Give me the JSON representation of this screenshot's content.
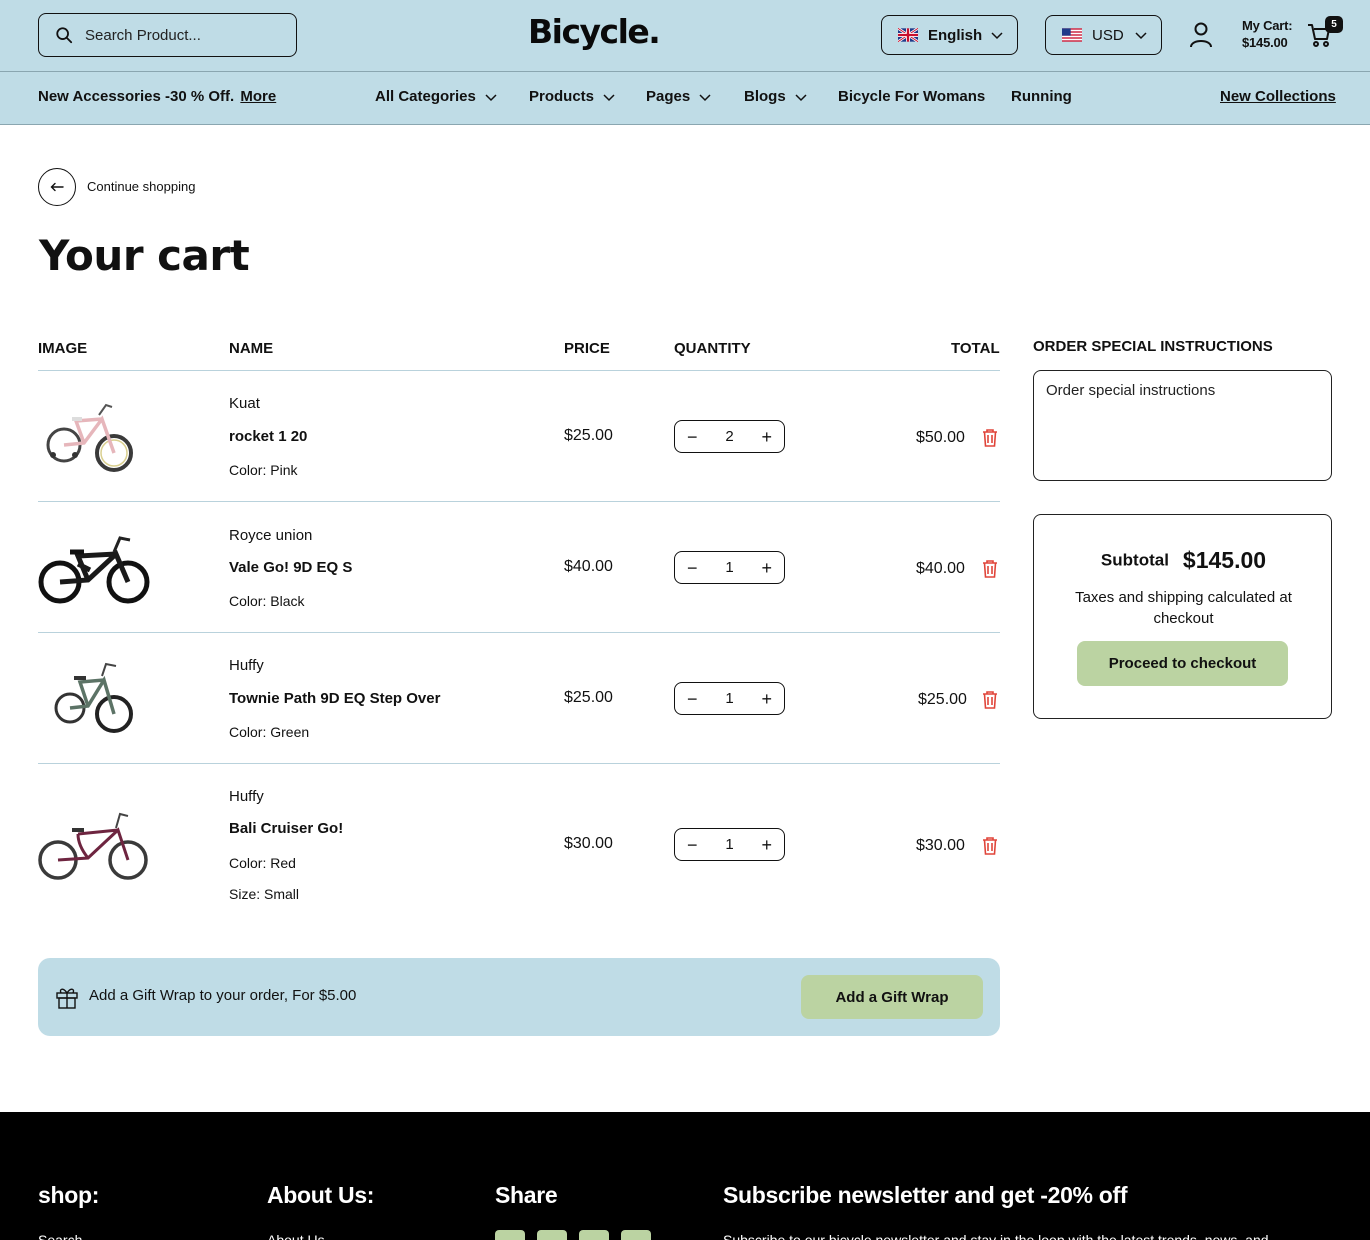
{
  "header": {
    "search_placeholder": "Search Product...",
    "logo": "Bicycle.",
    "language": "English",
    "currency": "USD",
    "cart_label": "My Cart:",
    "cart_total": "$145.00",
    "cart_count": "5"
  },
  "nav": {
    "promo_text": "New Accessories -30 % Off.",
    "promo_link": "More",
    "items": [
      "All Categories",
      "Products",
      "Pages",
      "Blogs",
      "Bicycle For Womans",
      "Running"
    ],
    "new_collections": "New Collections"
  },
  "page": {
    "continue": "Continue shopping",
    "title": "Your cart"
  },
  "table": {
    "headers": {
      "image": "IMAGE",
      "name": "NAME",
      "price": "PRICE",
      "quantity": "QUANTITY",
      "total": "TOTAL"
    },
    "rows": [
      {
        "brand": "Kuat",
        "name": "rocket 1 20",
        "color_label": "Color:",
        "color": "Pink",
        "price": "$25.00",
        "qty": "2",
        "total": "$50.00"
      },
      {
        "brand": "Royce union",
        "name": "Vale Go! 9D EQ S",
        "color_label": "Color:",
        "color": "Black",
        "price": "$40.00",
        "qty": "1",
        "total": "$40.00"
      },
      {
        "brand": "Huffy",
        "name": "Townie Path 9D EQ Step Over",
        "color_label": "Color:",
        "color": "Green",
        "price": "$25.00",
        "qty": "1",
        "total": "$25.00"
      },
      {
        "brand": "Huffy",
        "name": "Bali Cruiser Go!",
        "color_label": "Color:",
        "color": "Red",
        "size_label": "Size:",
        "size": "Small",
        "price": "$30.00",
        "qty": "1",
        "total": "$30.00"
      }
    ]
  },
  "sidebar": {
    "instructions_title": "ORDER SPECIAL INSTRUCTIONS",
    "instructions_placeholder": "Order special instructions",
    "subtotal_label": "Subtotal",
    "subtotal_value": "$145.00",
    "tax_note": "Taxes and shipping calculated at checkout",
    "checkout_label": "Proceed to checkout"
  },
  "gift": {
    "text": "Add a Gift Wrap to your order, For $5.00",
    "button": "Add a Gift Wrap"
  },
  "footer": {
    "col1": "shop:",
    "col2": "About Us:",
    "col3": "Share",
    "col4": "Subscribe newsletter and get -20% off",
    "link1": "Search",
    "link2": "About Us",
    "newsletter_text": "Subscribe to our bicycle newsletter and stay in the loop with the latest trends, news, and"
  },
  "colors": {
    "header_bg": "#bfdce6",
    "accent_green": "#bbd3a2",
    "delete_red": "#e0453a",
    "footer_bg": "#000000"
  },
  "icons": [
    "search-icon",
    "uk-flag-icon",
    "us-flag-icon",
    "chevron-down-icon",
    "user-icon",
    "cart-icon",
    "arrow-left-icon",
    "trash-icon",
    "gift-icon"
  ]
}
